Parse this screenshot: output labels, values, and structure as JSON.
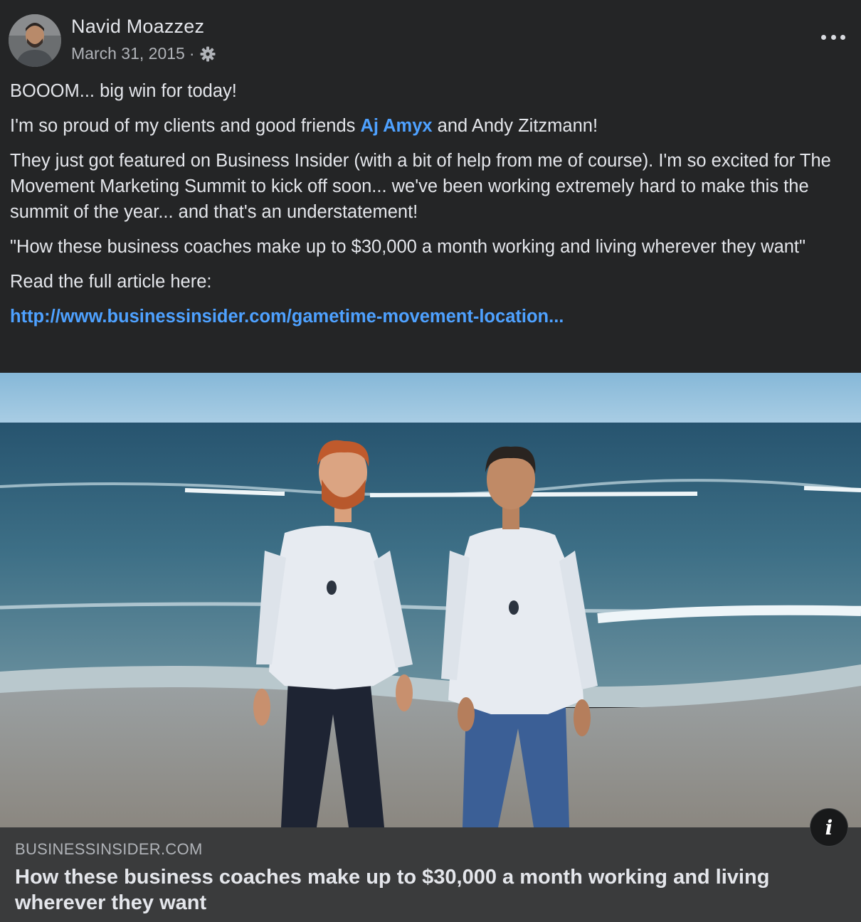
{
  "post": {
    "author_name": "Navid Moazzez",
    "date": "March 31, 2015",
    "separator": "·",
    "privacy_icon": "gear-icon",
    "more_icon": "more-options-icon"
  },
  "content": {
    "line1": "BOOOM... big win for today!",
    "line2_before": "I'm so proud of my clients and good friends ",
    "line2_mention": "Aj Amyx",
    "line2_after": " and Andy Zitzmann!",
    "paragraph3": "They just got featured on Business Insider (with a bit of help from me of course). I'm so excited for The Movement Marketing Summit to kick off soon... we've been working extremely hard to make this the summit of the year... and that's an understatement!",
    "quote": "\"How these business coaches make up to $30,000 a month working and living wherever they want\"",
    "read_more": "Read the full article here:",
    "url": "http://www.businessinsider.com/gametime-movement-location..."
  },
  "link_preview": {
    "domain": "BUSINESSINSIDER.COM",
    "title": "How these business coaches make up to $30,000 a month working and living wherever they want",
    "info_icon": "info-icon"
  },
  "colors": {
    "background": "#242526",
    "link": "#4ea1ff",
    "card": "#3a3b3c"
  }
}
